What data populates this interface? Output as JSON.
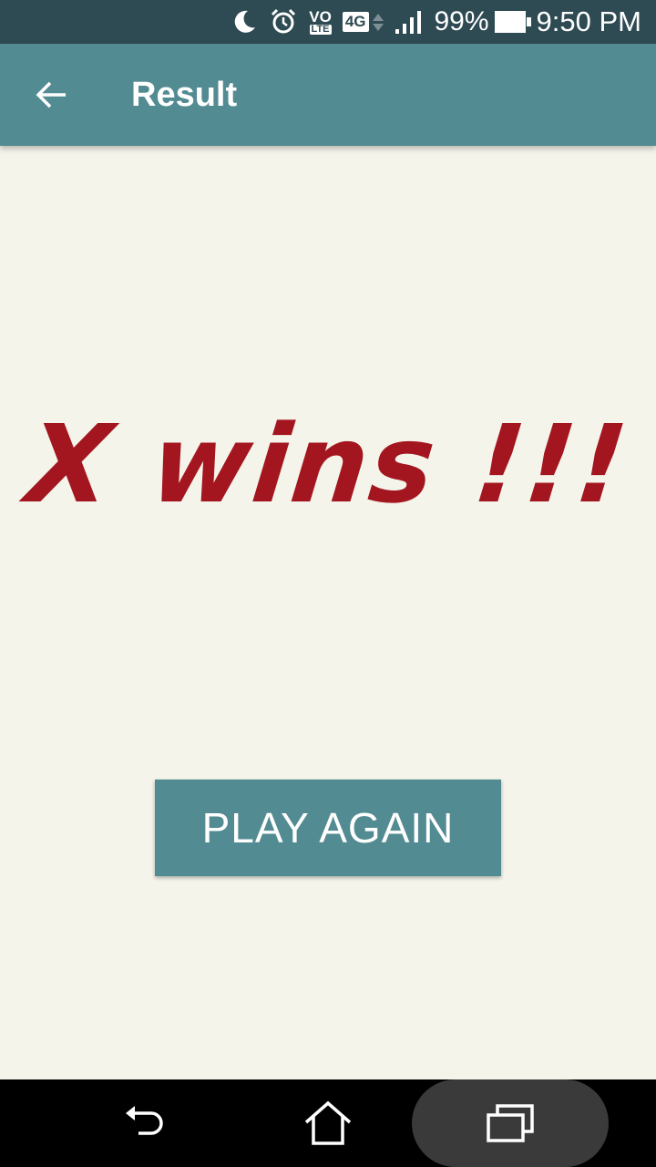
{
  "status_bar": {
    "time": "9:50 PM",
    "battery": "99%",
    "network": "4G",
    "volte_top": "VO",
    "volte_bottom": "LTE",
    "icons": [
      "moon-icon",
      "alarm-icon",
      "volte-icon",
      "4g-icon",
      "signal-icon",
      "battery-icon"
    ]
  },
  "app_bar": {
    "title": "Result",
    "back_icon": "arrow-back-icon"
  },
  "game": {
    "result": "X wins !!!"
  },
  "actions": {
    "play_again": "PLAY AGAIN"
  },
  "nav_bar": {
    "icons": [
      "nav-back-icon",
      "nav-home-icon",
      "nav-recents-icon"
    ]
  },
  "colors": {
    "app_bar": "#538b93",
    "status_bar": "#2e4a52",
    "background": "#f4f4eb",
    "result_text": "#a31620",
    "button": "#538b93"
  }
}
